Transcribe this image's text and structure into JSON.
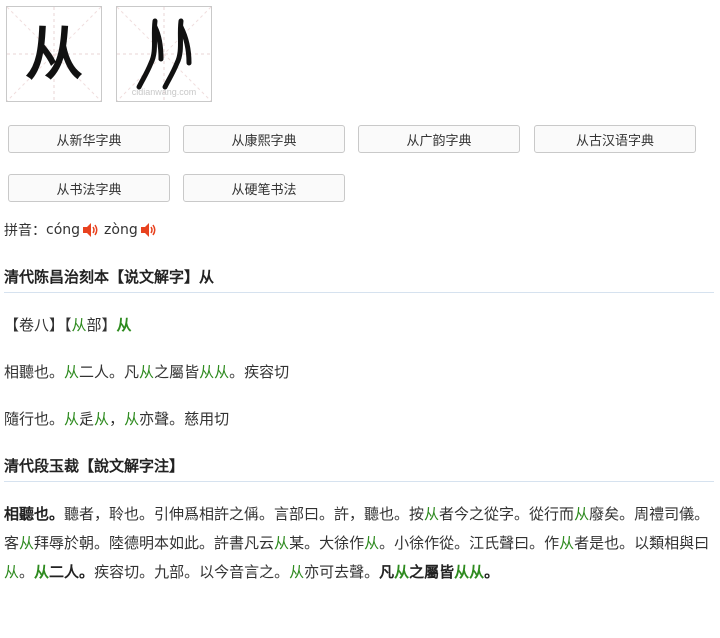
{
  "glyphs": {
    "main_char": "从",
    "watermark": "cidianwang.com"
  },
  "buttons": [
    "从新华字典",
    "从康熙字典",
    "从广韵字典",
    "从古汉语字典",
    "从书法字典",
    "从硬笔书法"
  ],
  "pinyin": {
    "label": "拼音：",
    "readings": [
      "cóng",
      "zòng"
    ]
  },
  "section1": {
    "heading": "清代陈昌治刻本【说文解字】从",
    "line1": {
      "a": "【卷八】【",
      "b": "从",
      "c": "部】",
      "d": "从"
    },
    "line2": {
      "t1": "相聽也。",
      "g1": "从",
      "t2": "二人。凡",
      "g2": "从",
      "t3": "之屬皆",
      "g3": "从从",
      "t4": "。疾容切"
    },
    "line3": {
      "t1": "隨行也。",
      "g1": "从",
      "t2": "辵",
      "g2": "从",
      "t3": "，",
      "g3": "从",
      "t4": "亦聲。慈用切"
    }
  },
  "section2": {
    "heading": "清代段玉裁【說文解字注】",
    "p": {
      "b1": "相聽也。",
      "t1": "聽者，聆也。引伸爲相許之偁。言部曰。許，聽也。按",
      "g1": "从",
      "t2": "者今之從字。從行而",
      "g2": "从",
      "t3": "廢矣。周禮司儀。客",
      "g3": "从",
      "t4": "拜辱於朝。陸德明本如此。許書凡云",
      "g4": "从",
      "t5": "某。大徐作",
      "g5": "从",
      "t6": "。小徐作從。江氏聲曰。作",
      "g6": "从",
      "t7": "者是也。以類相與曰",
      "g7": "从",
      "t8": "。",
      "gb1": "从",
      "b2": "二人。",
      "t9": "疾容切。九部。以今音言之。",
      "g8": "从",
      "t10": "亦可去聲。",
      "b3": "凡",
      "gb2": "从",
      "b4": "之屬皆",
      "gb3": "从从",
      "b5": "。"
    }
  },
  "colors": {
    "accent_green": "#2e8b1f",
    "speaker_red": "#e8421f",
    "rule": "#d6e2ef"
  },
  "icons": [
    "speaker-icon"
  ]
}
